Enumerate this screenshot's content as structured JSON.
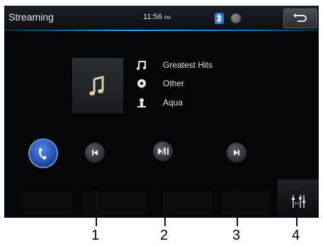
{
  "header": {
    "title": "Streaming",
    "clock_time": "11:56",
    "clock_ampm": "PM",
    "bluetooth_icon": "bluetooth-icon",
    "back_icon": "back-arrow-icon"
  },
  "track": {
    "album": "Greatest Hits",
    "genre": "Other",
    "artist": "Aqua"
  },
  "controls": {
    "prev_icon": "previous-track-icon",
    "play_pause_icon": "play-pause-icon",
    "next_icon": "next-track-icon",
    "phone_icon": "phone-icon",
    "eq_icon": "equalizer-icon"
  },
  "callouts": [
    "1",
    "2",
    "3",
    "4"
  ],
  "colors": {
    "screen_bg": "#050608",
    "accent_blue": "#3aa6d8",
    "bluetooth": "#2979d6",
    "phone": "#1b3f9a"
  }
}
